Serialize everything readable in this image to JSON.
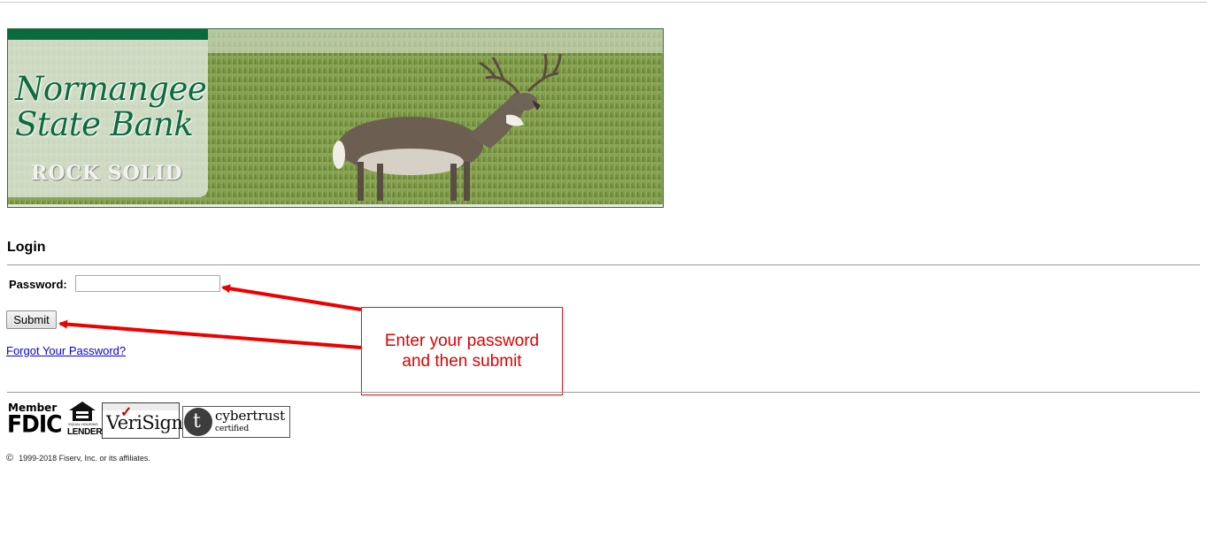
{
  "banner": {
    "bank_name": "Normangee\nState Bank",
    "tagline": "ROCK SOLID",
    "image_subject": "white-tailed deer in grass field"
  },
  "login": {
    "heading": "Login",
    "password_label": "Password:",
    "password_value": "",
    "submit_label": "Submit",
    "forgot_link": "Forgot Your Password?"
  },
  "annotation": {
    "text": "Enter your password\nand then submit",
    "color": "#e00000"
  },
  "badges": {
    "fdic_top": "Member",
    "fdic_main": "FDIC",
    "ehl_caption": "EQUAL HOUSING",
    "ehl_main": "LENDER",
    "verisign": "VeriSign",
    "cybertrust_logo": "t",
    "cybertrust_name": "cybertrust",
    "cybertrust_sub": "certified"
  },
  "footer": {
    "copyright_symbol": "©",
    "copyright_text": "1999-2018 Fiserv, Inc. or its affiliates."
  },
  "colors": {
    "brand_green": "#0d6b3f",
    "link_blue": "#0000ee"
  }
}
